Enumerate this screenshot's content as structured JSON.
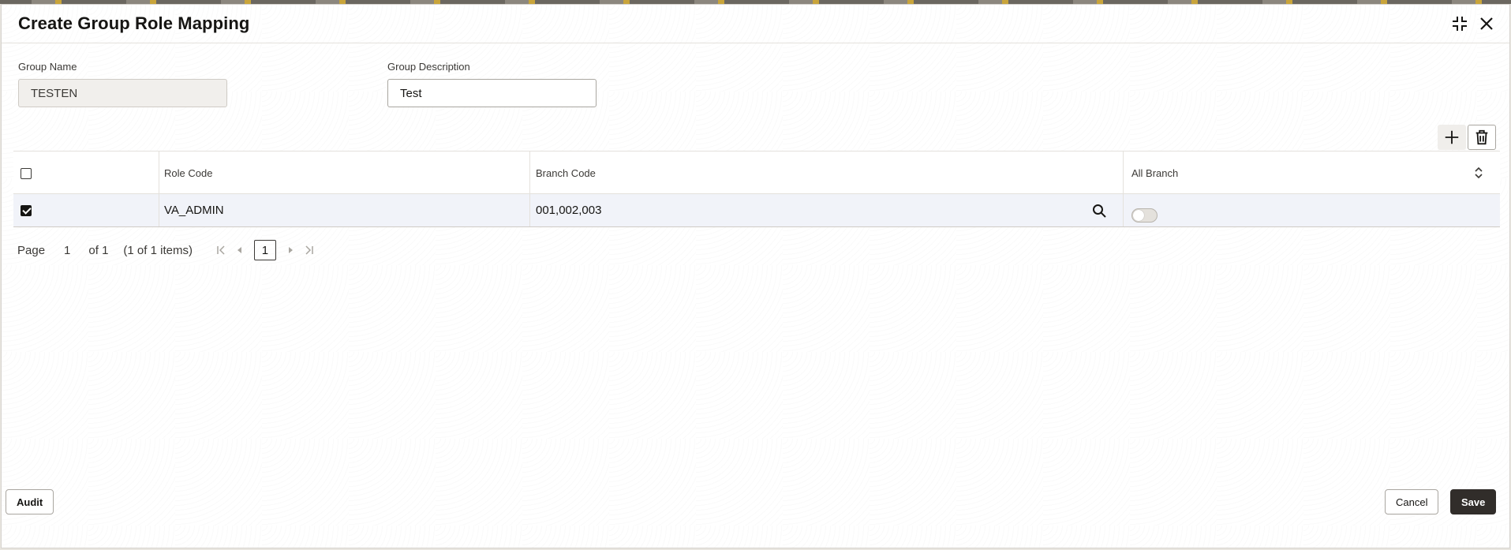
{
  "dialog": {
    "title": "Create Group Role Mapping",
    "icons": {
      "minimize": "collapse-icon",
      "close": "close-icon"
    }
  },
  "form": {
    "group_name": {
      "label": "Group Name",
      "value": "TESTEN"
    },
    "group_description": {
      "label": "Group Description",
      "value": "Test"
    }
  },
  "toolbar": {
    "add": "plus-icon",
    "delete": "trash-icon"
  },
  "table": {
    "columns": [
      "Role Code",
      "Branch Code",
      "All Branch"
    ],
    "rows": [
      {
        "selected": true,
        "role_code": "VA_ADMIN",
        "branch_code": "001,002,003",
        "all_branch": false
      }
    ]
  },
  "pagination": {
    "page_label": "Page",
    "current_page": "1",
    "of_label": "of 1",
    "items_label": "(1 of 1 items)",
    "page_button": "1"
  },
  "footer": {
    "audit_label": "Audit",
    "cancel_label": "Cancel",
    "save_label": "Save"
  },
  "colors": {
    "primary_button": "#312d2a",
    "row_highlight": "#f1f3f9"
  }
}
